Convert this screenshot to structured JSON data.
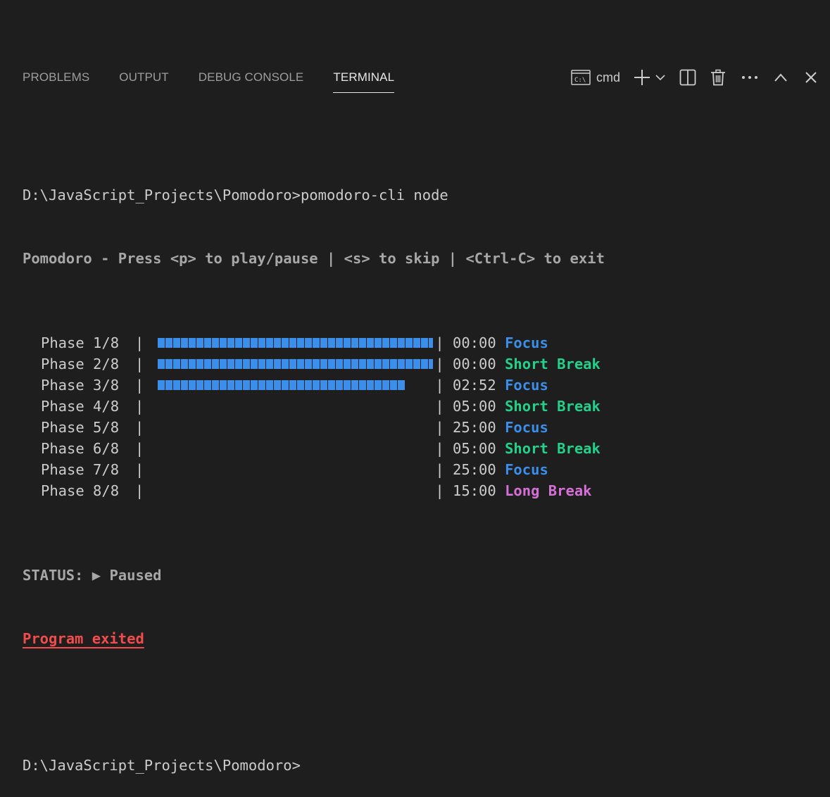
{
  "tabs": [
    {
      "label": "PROBLEMS",
      "active": false
    },
    {
      "label": "OUTPUT",
      "active": false
    },
    {
      "label": "DEBUG CONSOLE",
      "active": false
    },
    {
      "label": "TERMINAL",
      "active": true
    }
  ],
  "toolbar": {
    "shell_label": "cmd",
    "shell_icon": "terminal-cmd-icon",
    "icons": [
      "terminal-cmd-icon",
      "plus-icon",
      "chevron-down-icon",
      "split-icon",
      "trash-icon",
      "more-icon",
      "chevron-up-icon",
      "close-icon"
    ]
  },
  "terminal": {
    "prompt_command": "D:\\JavaScript_Projects\\Pomodoro>pomodoro-cli node",
    "header": "Pomodoro - Press <p> to play/pause | <s> to skip | <Ctrl-C> to exit",
    "phases": [
      {
        "name": "Phase 1/8",
        "progress": 1.0,
        "time": "00:00",
        "label": "Focus",
        "color": "#3b8eea"
      },
      {
        "name": "Phase 2/8",
        "progress": 1.0,
        "time": "00:00",
        "label": "Short Break",
        "color": "#23d18b"
      },
      {
        "name": "Phase 3/8",
        "progress": 0.9,
        "time": "02:52",
        "label": "Focus",
        "color": "#3b8eea"
      },
      {
        "name": "Phase 4/8",
        "progress": 0.0,
        "time": "05:00",
        "label": "Short Break",
        "color": "#23d18b"
      },
      {
        "name": "Phase 5/8",
        "progress": 0.0,
        "time": "25:00",
        "label": "Focus",
        "color": "#3b8eea"
      },
      {
        "name": "Phase 6/8",
        "progress": 0.0,
        "time": "05:00",
        "label": "Short Break",
        "color": "#23d18b"
      },
      {
        "name": "Phase 7/8",
        "progress": 0.0,
        "time": "25:00",
        "label": "Focus",
        "color": "#3b8eea"
      },
      {
        "name": "Phase 8/8",
        "progress": 0.0,
        "time": "15:00",
        "label": "Long Break",
        "color": "#d670d6"
      }
    ],
    "status_label": "STATUS:",
    "status_icon": "▶",
    "status_value": "Paused",
    "exit_message": "Program exited",
    "final_prompt": "D:\\JavaScript_Projects\\Pomodoro>"
  },
  "colors": {
    "background": "#1e1e1e",
    "focus": "#3b8eea",
    "short_break": "#23d18b",
    "long_break": "#d670d6",
    "error": "#f14c4c"
  }
}
